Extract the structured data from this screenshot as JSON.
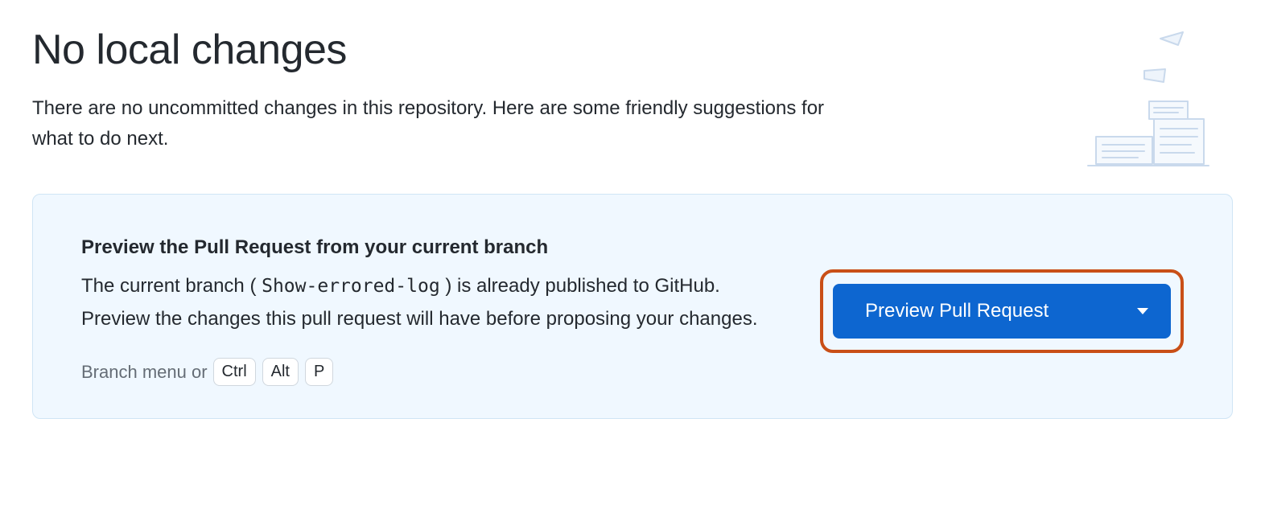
{
  "header": {
    "title": "No local changes",
    "subtitle": "There are no uncommitted changes in this repository. Here are some friendly suggestions for what to do next."
  },
  "suggestion": {
    "title": "Preview the Pull Request from your current branch",
    "body_prefix": "The current branch (",
    "branch_name": "Show-errored-log",
    "body_suffix": ") is already published to GitHub. Preview the changes this pull request will have before proposing your changes.",
    "hint_prefix": "Branch menu or",
    "keys": {
      "k1": "Ctrl",
      "k2": "Alt",
      "k3": "P"
    },
    "button_label": "Preview Pull Request"
  },
  "colors": {
    "accent": "#0d66d0",
    "highlight_border": "#c94f17",
    "panel_bg": "#f0f8ff"
  }
}
